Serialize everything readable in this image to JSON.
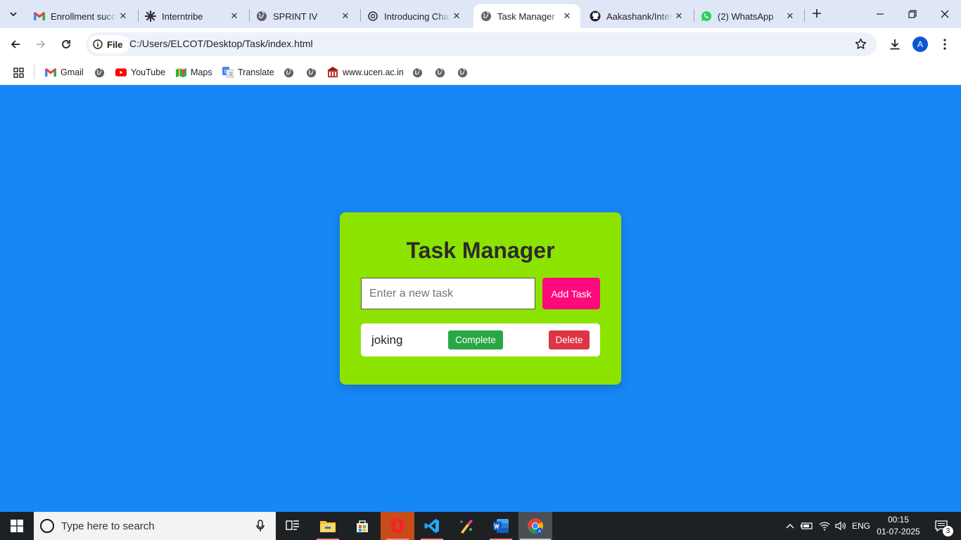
{
  "browser": {
    "tabs": [
      {
        "title": "Enrollment succe",
        "favicon": "gmail-icon",
        "active": false
      },
      {
        "title": "Interntribe",
        "favicon": "interntribe-icon",
        "active": false
      },
      {
        "title": "SPRINT IV",
        "favicon": "globe-icon",
        "active": false
      },
      {
        "title": "Introducing Chat",
        "favicon": "openai-icon",
        "active": false
      },
      {
        "title": "Task Manager",
        "favicon": "globe-icon",
        "active": true
      },
      {
        "title": "Aakashank/Inter",
        "favicon": "github-icon",
        "active": false
      },
      {
        "title": "(2) WhatsApp",
        "favicon": "whatsapp-icon",
        "active": false
      }
    ],
    "address_bar": {
      "scheme_chip": "File",
      "url": "C:/Users/ELCOT/Desktop/Task/index.html"
    },
    "profile_initial": "A",
    "bookmarks": [
      {
        "label": "Gmail",
        "icon": "gmail-icon"
      },
      {
        "label": "",
        "icon": "globe-icon"
      },
      {
        "label": "YouTube",
        "icon": "youtube-icon"
      },
      {
        "label": "Maps",
        "icon": "maps-icon"
      },
      {
        "label": "Translate",
        "icon": "translate-icon"
      },
      {
        "label": "",
        "icon": "globe-icon"
      },
      {
        "label": "",
        "icon": "globe-icon"
      },
      {
        "label": "www.ucen.ac.in",
        "icon": "ucen-icon"
      },
      {
        "label": "",
        "icon": "globe-icon"
      },
      {
        "label": "",
        "icon": "globe-icon"
      },
      {
        "label": "",
        "icon": "globe-icon"
      }
    ]
  },
  "page": {
    "background": "#1787f5",
    "card_color": "#8de300",
    "title": "Task Manager",
    "input_placeholder": "Enter a new task",
    "input_value": "",
    "add_button": "Add Task",
    "tasks": [
      {
        "text": "joking",
        "complete_label": "Complete",
        "delete_label": "Delete"
      }
    ],
    "colors": {
      "add": "#ff0a7a",
      "complete": "#28a745",
      "delete": "#dc3545"
    }
  },
  "taskbar": {
    "search_placeholder": "Type here to search",
    "apps": [
      "task-view-icon",
      "file-explorer-icon",
      "store-icon",
      "opera-icon",
      "vscode-icon",
      "paint-icon",
      "word-icon",
      "chrome-icon"
    ],
    "language": "ENG",
    "time": "00:15",
    "date": "01-07-2025",
    "notification_count": "3"
  }
}
